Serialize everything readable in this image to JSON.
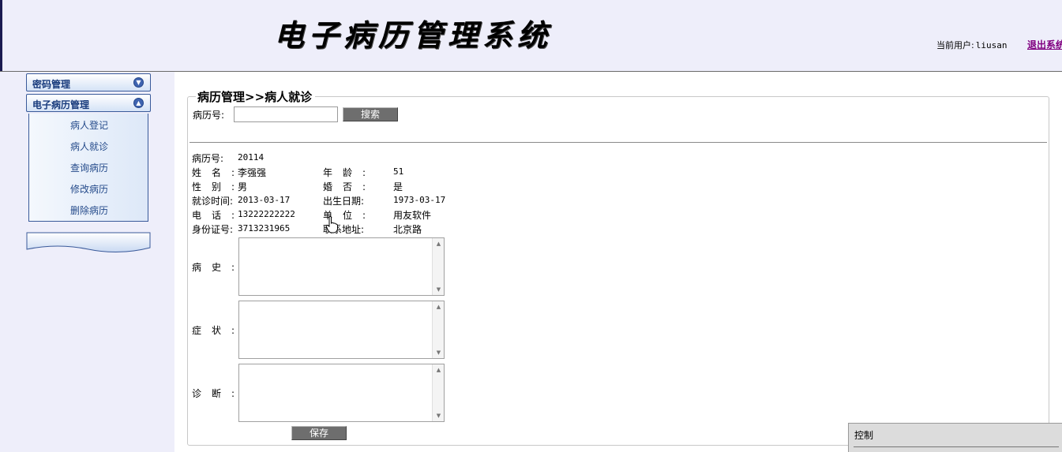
{
  "header": {
    "title": "电子病历管理系统",
    "current_user_label": "当前用户:",
    "current_user_name": "liusan",
    "logout_label": "退出系统"
  },
  "sidebar": {
    "sections": [
      {
        "label": "密码管理",
        "state": "collapsed",
        "icon": "chevron-down-icon"
      },
      {
        "label": "电子病历管理",
        "state": "expanded",
        "icon": "chevron-up-icon"
      }
    ],
    "items": [
      "病人登记",
      "病人就诊",
      "查询病历",
      "修改病历",
      "删除病历"
    ]
  },
  "main": {
    "breadcrumb": "病历管理>>病人就诊",
    "search": {
      "label": "病历号:",
      "value": "",
      "button_label": "搜索"
    },
    "patient": {
      "record_no_label": "病历号:",
      "record_no": "20114",
      "name_label": "姓名:",
      "name": "李强强",
      "age_label": "年龄:",
      "age": "51",
      "gender_label": "性别:",
      "gender": "男",
      "married_label": "婚否:",
      "married": "是",
      "visit_date_label": "就诊时间:",
      "visit_date": "2013-03-17",
      "birth_date_label": "出生日期:",
      "birth_date": "1973-03-17",
      "phone_label": "电话:",
      "phone": "13222222222",
      "employer_label": "单位:",
      "employer": "用友软件",
      "id_no_label": "身份证号:",
      "id_no": "3713231965",
      "address_label": "联系地址:",
      "address": "北京路"
    },
    "fields": {
      "history_label": "病史:",
      "history_value": "",
      "symptoms_label": "症状:",
      "symptoms_value": "",
      "diagnosis_label": "诊断:",
      "diagnosis_value": ""
    },
    "save_label": "保存"
  },
  "control_window": {
    "title": "控制"
  }
}
